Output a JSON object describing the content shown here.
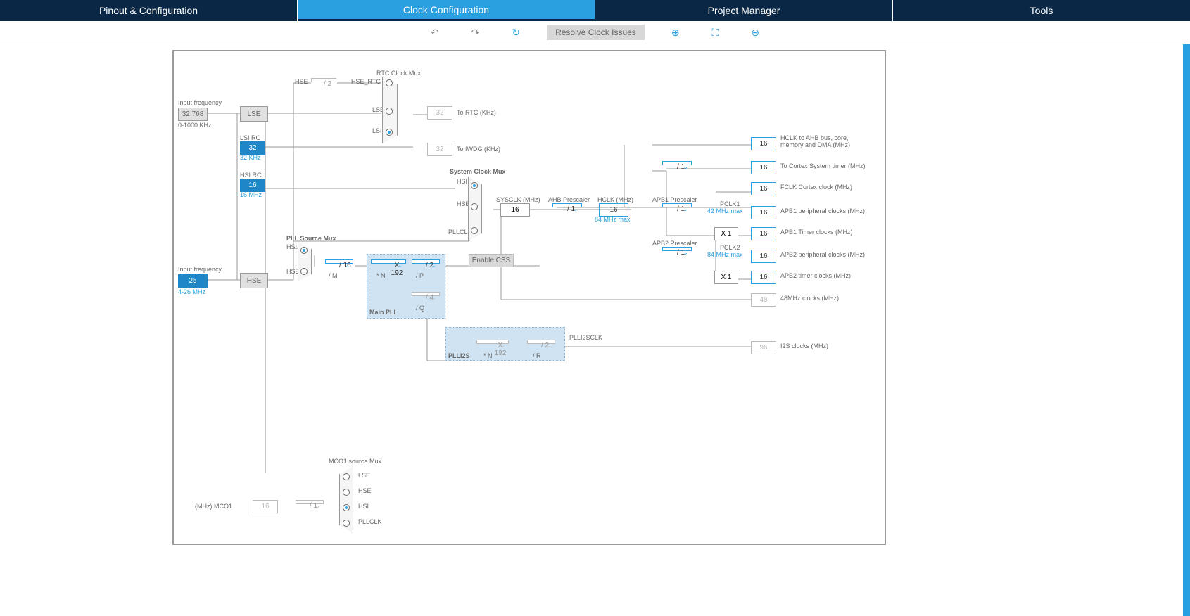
{
  "tabs": {
    "pinout": "Pinout & Configuration",
    "clock": "Clock Configuration",
    "project": "Project Manager",
    "tools": "Tools"
  },
  "toolbar": {
    "resolve": "Resolve Clock Issues"
  },
  "inputs": {
    "lse_label": "Input frequency",
    "lse_value": "32.768",
    "lse_range": "0-1000 KHz",
    "lse_box": "LSE",
    "hse_label": "Input frequency",
    "hse_value": "25",
    "hse_range": "4-26 MHz",
    "hse_box": "HSE"
  },
  "osc": {
    "lsi_label": "LSI RC",
    "lsi_value": "32",
    "lsi_note": "32 KHz",
    "hsi_label": "HSI RC",
    "hsi_value": "16",
    "hsi_note": "16 MHz"
  },
  "rtc": {
    "title": "RTC Clock Mux",
    "hse": "HSE",
    "div": "/ 2",
    "hse_rtc": "HSE_RTC",
    "lse": "LSE",
    "lsi": "LSI",
    "out_val": "32",
    "out_lbl": "To RTC (KHz)",
    "iwdg_val": "32",
    "iwdg_lbl": "To IWDG (KHz)"
  },
  "pllsrc": {
    "title": "PLL Source Mux",
    "hsi": "HSI",
    "hse": "HSE",
    "m": "/ 16",
    "m_lbl": "/ M"
  },
  "pll": {
    "title": "Main PLL",
    "n": "X 192",
    "n_lbl": "* N",
    "p": "/ 2",
    "p_lbl": "/ P",
    "q": "/ 4",
    "q_lbl": "/ Q"
  },
  "plli2s": {
    "title": "PLLI2S",
    "n": "X 192",
    "n_lbl": "* N",
    "r": "/ 2",
    "r_lbl": "/ R",
    "clk": "PLLI2SCLK"
  },
  "sysmux": {
    "title": "System Clock Mux",
    "hsi": "HSI",
    "hse": "HSE",
    "pllclk": "PLLCLK",
    "css": "Enable CSS"
  },
  "sysclk": {
    "lbl": "SYSCLK (MHz)",
    "val": "16"
  },
  "ahb": {
    "lbl": "AHB Prescaler",
    "val": "/ 1"
  },
  "hclk": {
    "lbl": "HCLK (MHz)",
    "val": "16",
    "max": "84 MHz max"
  },
  "systick": {
    "val": "/ 1"
  },
  "apb1": {
    "lbl": "APB1 Prescaler",
    "val": "/ 1",
    "pclk": "PCLK1",
    "max": "42 MHz max",
    "tim": "X 1"
  },
  "apb2": {
    "lbl": "APB2 Prescaler",
    "val": "/ 1",
    "pclk": "PCLK2",
    "max": "84 MHz max",
    "tim": "X 1"
  },
  "outs": {
    "hclk_ahb": "HCLK to AHB bus, core, memory and DMA (MHz)",
    "hclk_ahb_v": "16",
    "systick": "To Cortex System timer (MHz)",
    "systick_v": "16",
    "fclk": "FCLK Cortex clock (MHz)",
    "fclk_v": "16",
    "apb1p": "APB1 peripheral clocks (MHz)",
    "apb1p_v": "16",
    "apb1t": "APB1 Timer clocks (MHz)",
    "apb1t_v": "16",
    "apb2p": "APB2 peripheral clocks (MHz)",
    "apb2p_v": "16",
    "apb2t": "APB2 timer clocks (MHz)",
    "apb2t_v": "16",
    "clk48": "48MHz clocks (MHz)",
    "clk48_v": "48",
    "i2s": "I2S clocks (MHz)",
    "i2s_v": "96"
  },
  "mco": {
    "title": "MCO1 source Mux",
    "lse": "LSE",
    "hse": "HSE",
    "hsi": "HSI",
    "pllclk": "PLLCLK",
    "div": "/ 1",
    "val": "16",
    "lbl": "(MHz) MCO1"
  }
}
